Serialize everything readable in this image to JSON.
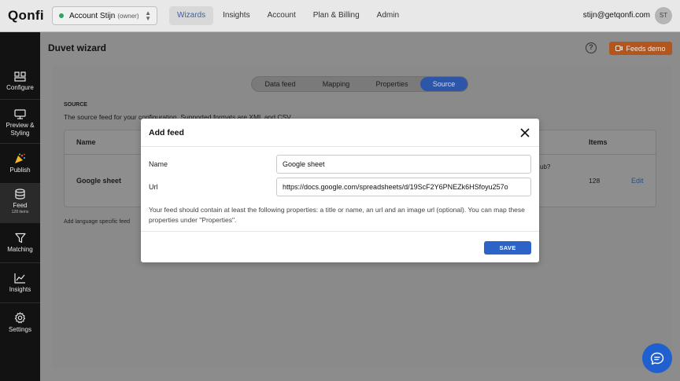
{
  "app": {
    "logo": "Qonfi"
  },
  "account": {
    "name": "Account Stijn",
    "role": "(owner)",
    "status_color": "#27a85a"
  },
  "nav": {
    "items": [
      {
        "label": "Wizards",
        "active": true
      },
      {
        "label": "Insights",
        "active": false
      },
      {
        "label": "Account",
        "active": false
      },
      {
        "label": "Plan & Billing",
        "active": false
      },
      {
        "label": "Admin",
        "active": false
      }
    ]
  },
  "user": {
    "email": "stijn@getqonfi.com",
    "initials": "ST"
  },
  "sidebar": {
    "items": [
      {
        "label": "Configure",
        "icon": "configure-icon"
      },
      {
        "label": "Preview & Styling",
        "icon": "monitor-icon"
      },
      {
        "label": "Publish",
        "icon": "party-popper-icon"
      },
      {
        "label": "Feed",
        "sublabel": "128 items",
        "icon": "database-icon",
        "active": true
      },
      {
        "label": "Matching",
        "icon": "funnel-icon"
      },
      {
        "label": "Insights",
        "icon": "chart-line-icon"
      },
      {
        "label": "Settings",
        "icon": "gear-icon"
      }
    ]
  },
  "page": {
    "title": "Duvet wizard",
    "demo_button": "Feeds demo",
    "demo_color": "#e8732c"
  },
  "tabs": [
    {
      "label": "Data feed",
      "active": false
    },
    {
      "label": "Mapping",
      "active": false
    },
    {
      "label": "Properties",
      "active": false
    },
    {
      "label": "Source",
      "active": true
    }
  ],
  "source": {
    "heading": "SOURCE",
    "description": "The source feed for your configuration. Supported formats are XML and CSV."
  },
  "table": {
    "columns": {
      "name": "Name",
      "items": "Items"
    },
    "rows": [
      {
        "name": "Google sheet",
        "partial_text": "ub?",
        "items": "128",
        "action": "Edit"
      }
    ]
  },
  "language_note": "Add language specific feed",
  "modal": {
    "title": "Add feed",
    "name_label": "Name",
    "name_value": "Google sheet",
    "url_label": "Url",
    "url_value": "https://docs.google.com/spreadsheets/d/19ScF2Y6PNEZk6HSfoyu257o",
    "hint": "Your feed should contain at least the following properties: a title or name, an url and an image url (optional). You can map these properties under \"Properties\".",
    "save_label": "SAVE",
    "accent": "#2d62c6"
  },
  "chat": {
    "icon": "chat-bubble-icon",
    "color": "#1f5fd0"
  }
}
